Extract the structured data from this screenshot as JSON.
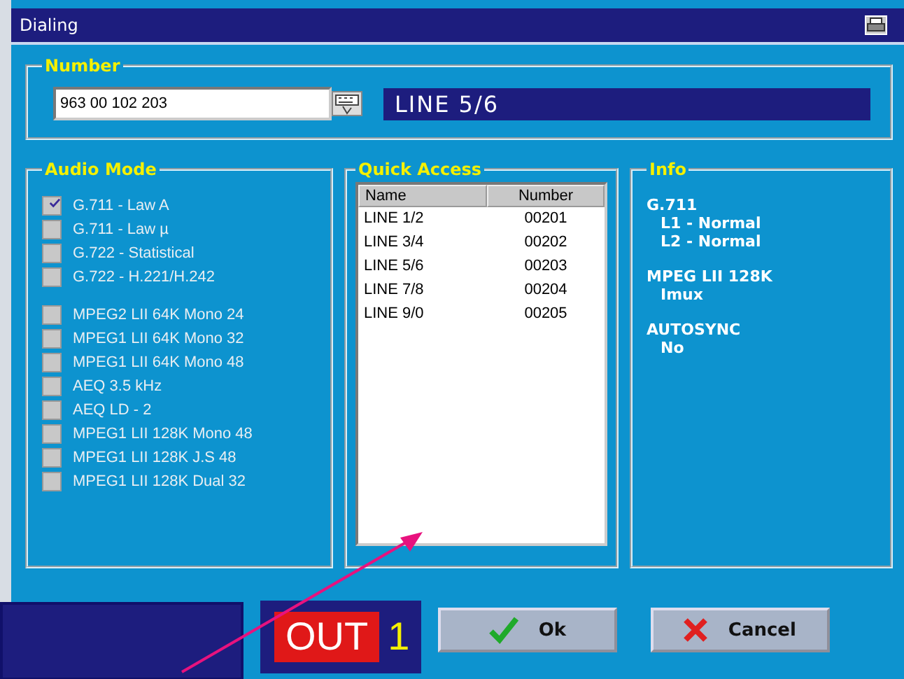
{
  "window": {
    "title": "Dialing"
  },
  "number": {
    "legend": "Number",
    "value": "963 00 102 203",
    "line_display": "LINE 5/6"
  },
  "audio_mode": {
    "legend": "Audio Mode",
    "groups": [
      [
        {
          "label": "G.711 - Law A",
          "checked": true
        },
        {
          "label": "G.711 - Law µ",
          "checked": false
        },
        {
          "label": "G.722 - Statistical",
          "checked": false
        },
        {
          "label": "G.722 - H.221/H.242",
          "checked": false
        }
      ],
      [
        {
          "label": "MPEG2 LII 64K Mono 24",
          "checked": false
        },
        {
          "label": "MPEG1 LII 64K Mono 32",
          "checked": false
        },
        {
          "label": "MPEG1 LII 64K Mono 48",
          "checked": false
        },
        {
          "label": "AEQ 3.5 kHz",
          "checked": false
        },
        {
          "label": "AEQ LD - 2",
          "checked": false
        },
        {
          "label": "MPEG1 LII 128K Mono 48",
          "checked": false
        },
        {
          "label": "MPEG1 LII 128K J.S 48",
          "checked": false
        },
        {
          "label": "MPEG1 LII 128K Dual 32",
          "checked": false
        }
      ]
    ]
  },
  "quick_access": {
    "legend": "Quick Access",
    "columns": [
      "Name",
      "Number"
    ],
    "rows": [
      [
        "LINE 1/2",
        "00201"
      ],
      [
        "LINE 3/4",
        "00202"
      ],
      [
        "LINE 5/6",
        "00203"
      ],
      [
        "LINE 7/8",
        "00204"
      ],
      [
        "LINE 9/0",
        "00205"
      ]
    ]
  },
  "info": {
    "legend": "Info",
    "sections": [
      {
        "heading": "G.711",
        "lines": [
          "L1 - Normal",
          "L2 - Normal"
        ]
      },
      {
        "heading": "MPEG LII 128K",
        "lines": [
          "Imux"
        ]
      },
      {
        "heading": "AUTOSYNC",
        "lines": [
          "No"
        ]
      }
    ]
  },
  "status": {
    "direction": "OUT",
    "channel": "1"
  },
  "buttons": [
    {
      "kind": "ok",
      "label": "Ok"
    },
    {
      "kind": "cancel",
      "label": "Cancel"
    }
  ]
}
